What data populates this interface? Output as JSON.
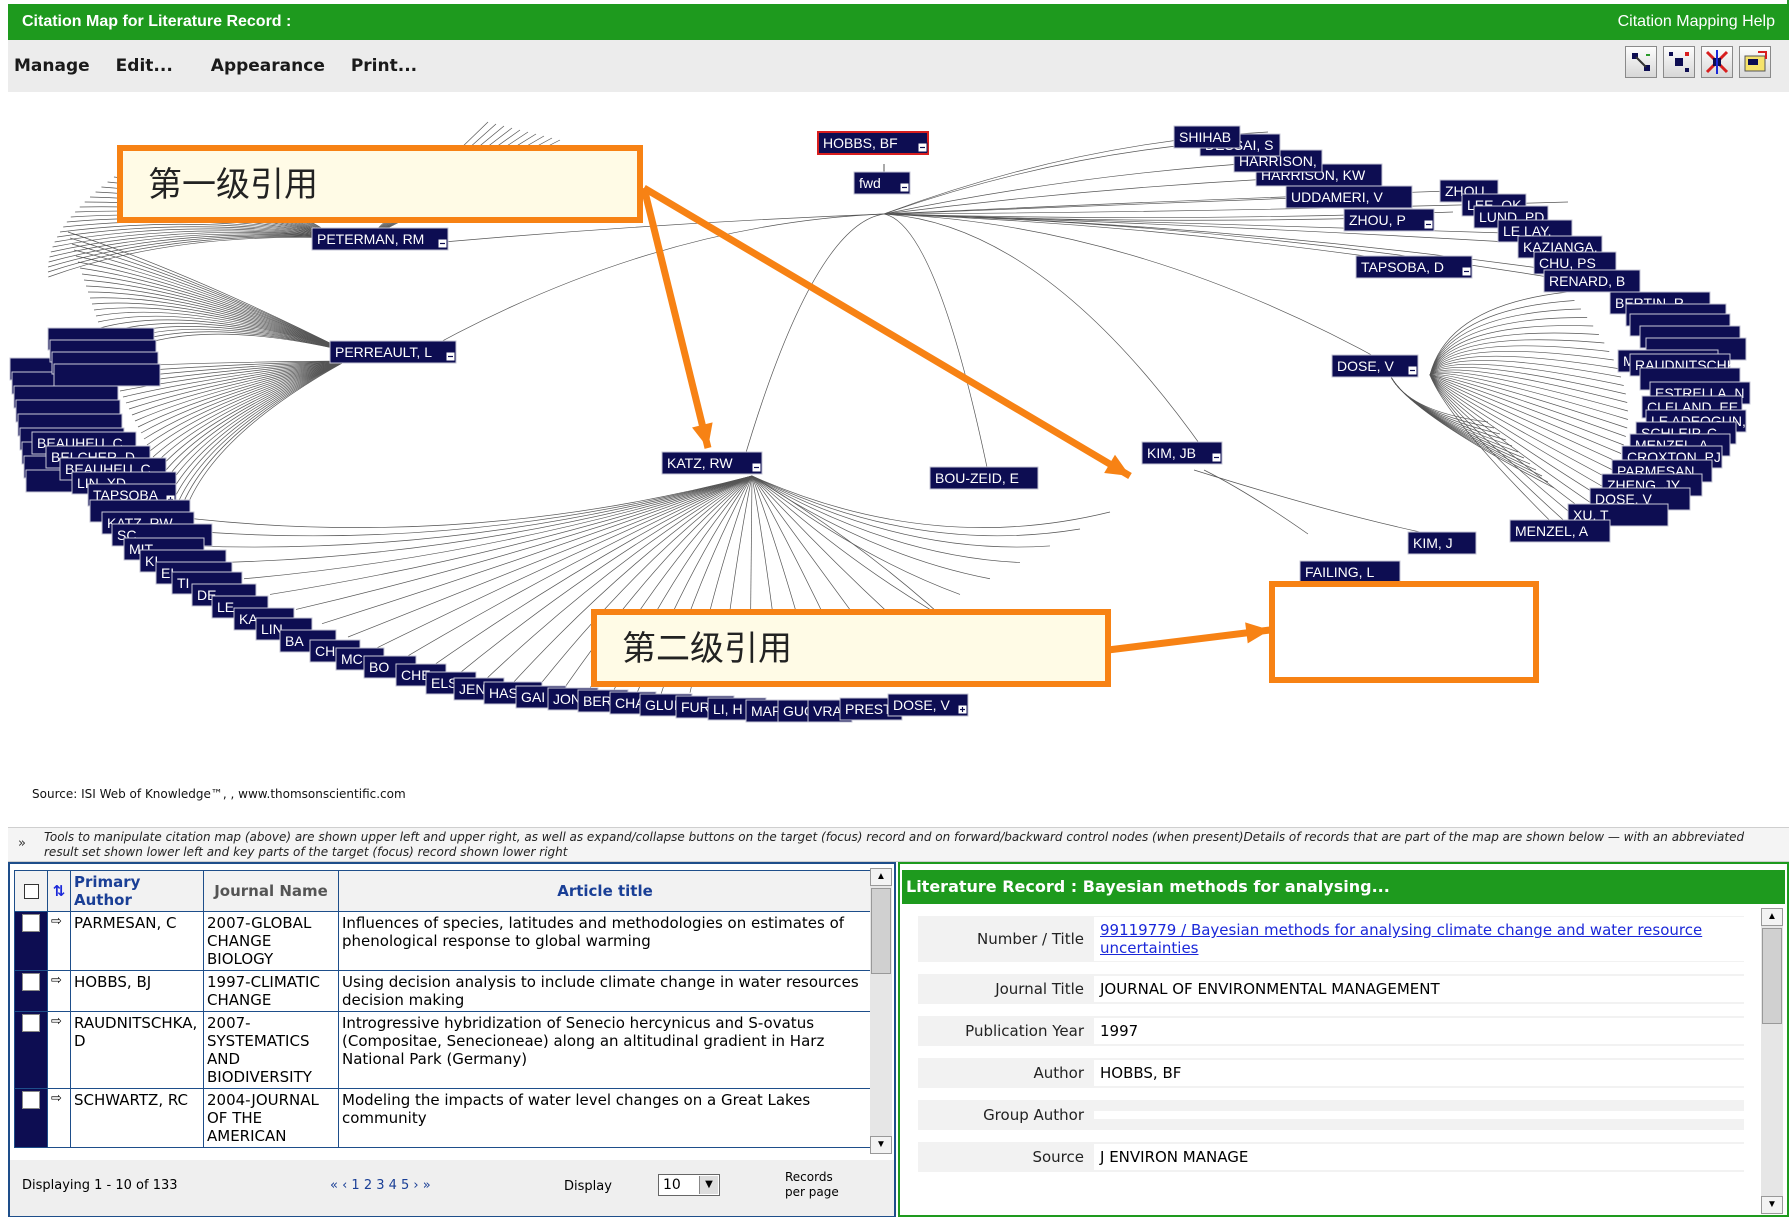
{
  "window": {
    "title": "Citation Map for  Literature Record :",
    "help": "Citation Mapping Help"
  },
  "menu": {
    "manage": "Manage",
    "edit": "Edit...",
    "appearance": "Appearance",
    "print": "Print..."
  },
  "toolbar_icons": [
    "map-tool-icon",
    "map-tool-icon",
    "map-tool-icon",
    "map-tool-icon"
  ],
  "map": {
    "focus": "HOBBS, BF",
    "fwd": "fwd",
    "nodes": [
      "PETERMAN, RM",
      "PERREAULT, L",
      "KATZ, RW",
      "BOU-ZEID, E",
      "KIM, JB",
      "DOSE, V",
      "TAPSOBA, D",
      "ZHOU, P",
      "UDDAMERI, V",
      "HARRISON, KW",
      "HARRISON,",
      "DESSAI, S",
      "SHIHAB",
      "KIM, J",
      "FAILING, L",
      "ZHOU,",
      "LEE, OK",
      "LUND, PD",
      "LE LAY,",
      "KAZIANGA,",
      "CHU, PS",
      "RENARD, B",
      "BERTIN, R",
      "RAUDNITSCHKA, D",
      "MENZEL, A",
      "ESTRELLA, N",
      "CLELAND, EE",
      "LE ADEOGUN, S",
      "SCHLEIP, C",
      "CROXTON, PJ",
      "PARMESAN,",
      "ZHENG, JY",
      "XU, T",
      "TAPSOBA",
      "KATZ, RW",
      "DOSE, V",
      "BEAUHEU, C",
      "BELCHER, D",
      "LIN, XD",
      "PRESTO",
      "VRA",
      "GUO",
      "MARE",
      "LI, H",
      "FURF",
      "GLUI",
      "CHA",
      "BER",
      "JON",
      "GAI",
      "HAS",
      "JEN",
      "ELS",
      "CHE",
      "BO",
      "MC",
      "CH",
      "BA",
      "LIN",
      "KA",
      "LE",
      "DE",
      "TI",
      "EL",
      "KI",
      "MIT",
      "SC",
      "KATZ, RW"
    ],
    "callout_first": "第一级引用",
    "callout_second": "第二级引用",
    "source": "Source: ISI Web of Knowledge™, , www.thomsonscientific.com"
  },
  "hint": "Tools to manipulate citation map (above) are shown upper left and upper right, as well as expand/collapse buttons on the target (focus) record and on forward/backward control nodes (when present)Details of records that are part of the map are shown below — with an abbreviated result set shown lower left and key parts of the target (focus) record shown lower right",
  "records": {
    "columns": {
      "author": "Primary Author",
      "journal": "Journal Name",
      "title": "Article title"
    },
    "rows": [
      {
        "author": "PARMESAN, C",
        "journal": "2007-GLOBAL CHANGE BIOLOGY",
        "title": "Influences of species, latitudes and methodologies on estimates of phenological response to global warming"
      },
      {
        "author": "HOBBS, BJ",
        "journal": "1997-CLIMATIC CHANGE",
        "title": "Using decision analysis to include climate change in water resources decision making"
      },
      {
        "author": "RAUDNITSCHKA, D",
        "journal": "2007-SYSTEMATICS AND BIODIVERSITY",
        "title": "Introgressive hybridization of Senecio hercynicus and S-ovatus (Compositae, Senecioneae) along an altitudinal gradient in Harz National Park (Germany)"
      },
      {
        "author": "SCHWARTZ, RC",
        "journal": "2004-JOURNAL OF THE AMERICAN",
        "title": "Modeling the impacts of water level changes on a Great Lakes community"
      }
    ],
    "displaying": "Displaying 1 - 10 of 133",
    "pager": "« ‹ 1 2 3 4 5 › »",
    "display_label": "Display",
    "per_page": "10",
    "per_page_label": "Records per page"
  },
  "detail": {
    "header": "Literature Record : Bayesian methods for analysing...",
    "fields": [
      {
        "label": "Number / Title",
        "value": "99119779 / Bayesian methods for analysing climate change and water resource uncertainties"
      },
      {
        "label": "Journal Title",
        "value": "JOURNAL OF ENVIRONMENTAL MANAGEMENT"
      },
      {
        "label": "Publication Year",
        "value": "1997"
      },
      {
        "label": "Author",
        "value": "HOBBS, BF"
      },
      {
        "label": "Group Author",
        "value": ""
      },
      {
        "label": "Source",
        "value": "J ENVIRON MANAGE"
      }
    ]
  },
  "colors": {
    "green": "#1e9a1e",
    "node": "#0d0d52",
    "orange": "#f78214",
    "focus_border": "#d81e1e"
  }
}
